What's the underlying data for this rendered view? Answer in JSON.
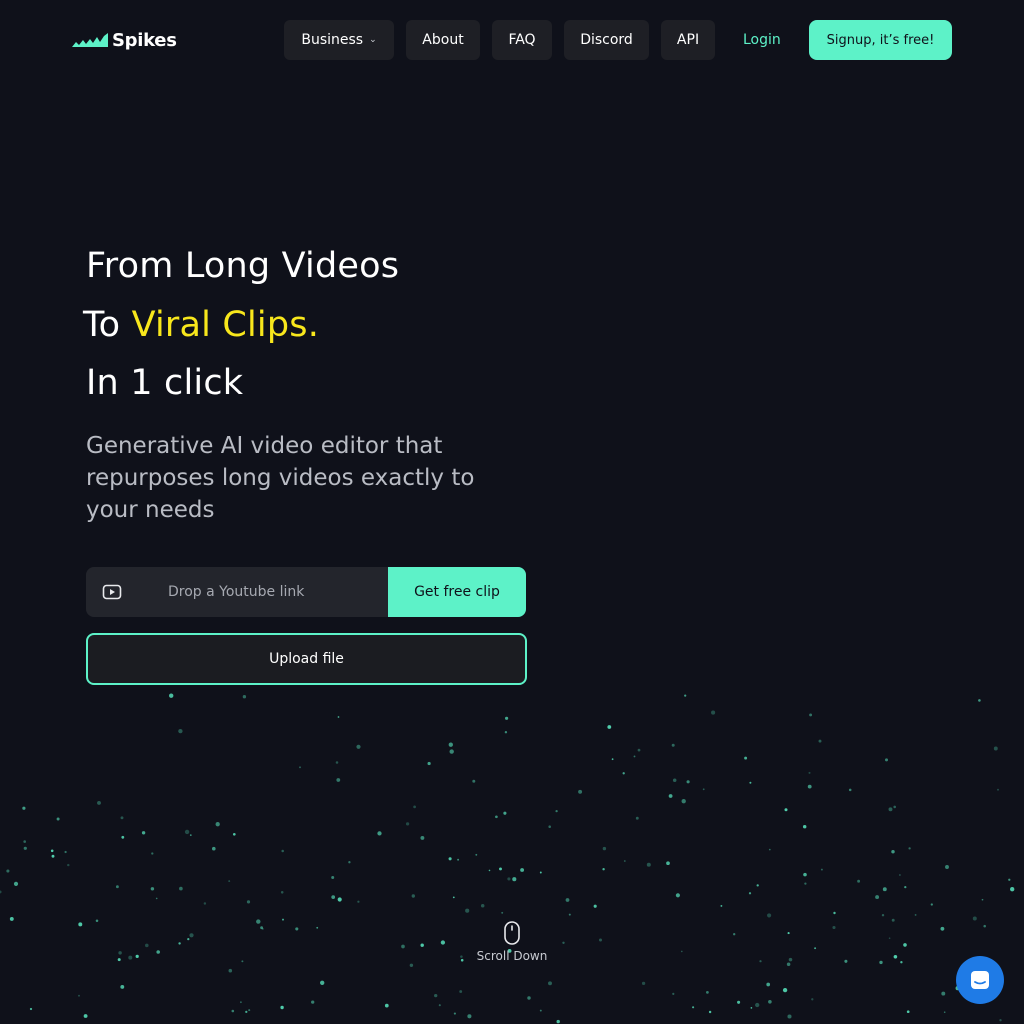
{
  "brand": {
    "name": "Spikes",
    "accent_color": "#5df2c8",
    "highlight_color": "#f8e71c"
  },
  "nav": {
    "items": [
      {
        "label": "Business",
        "has_dropdown": true
      },
      {
        "label": "About"
      },
      {
        "label": "FAQ"
      },
      {
        "label": "Discord"
      },
      {
        "label": "API"
      }
    ],
    "login_label": "Login",
    "signup_label": "Signup, it’s free!"
  },
  "hero": {
    "line1": "From Long Videos",
    "line2_prefix": "To ",
    "line2_highlight": "Viral Clips.",
    "line3": "In 1 click",
    "subtitle": "Generative AI video editor that repurposes long videos exactly to your needs"
  },
  "clip_form": {
    "input_icon": "youtube-icon",
    "input_placeholder": "Drop a Youtube link",
    "input_value": "",
    "submit_label": "Get free clip",
    "upload_label": "Upload file"
  },
  "scroll_hint": {
    "icon": "mouse-icon",
    "label": "Scroll Down"
  },
  "chat_widget": {
    "icon": "chat-icon"
  }
}
